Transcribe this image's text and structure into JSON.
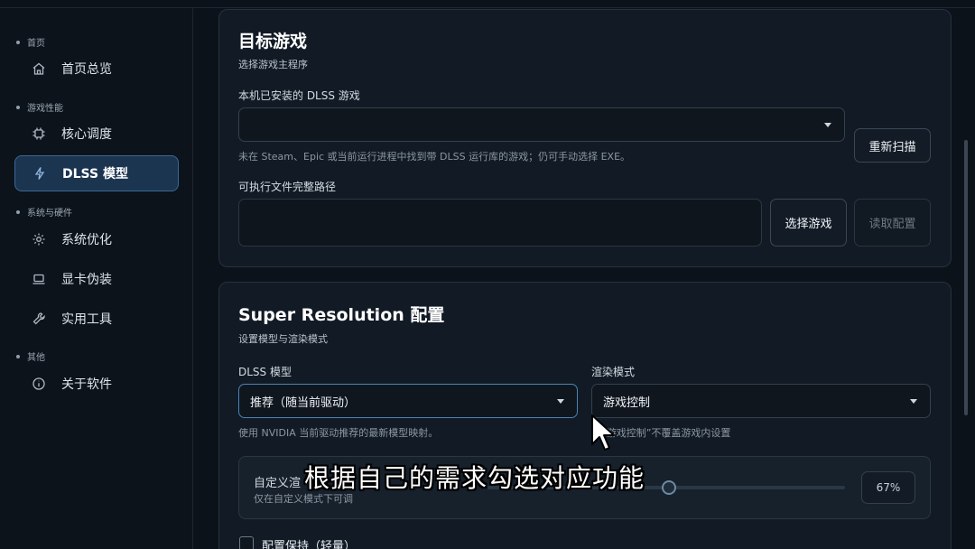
{
  "sidebar": {
    "sections": [
      "首页",
      "游戏性能",
      "系统与硬件",
      "其他"
    ],
    "items": [
      {
        "label": "首页总览",
        "icon": "home-icon"
      },
      {
        "label": "核心调度",
        "icon": "cpu-icon"
      },
      {
        "label": "DLSS 模型",
        "icon": "bolt-icon",
        "active": true
      },
      {
        "label": "系统优化",
        "icon": "gear-icon"
      },
      {
        "label": "显卡伪装",
        "icon": "laptop-icon"
      },
      {
        "label": "实用工具",
        "icon": "wrench-icon"
      },
      {
        "label": "关于软件",
        "icon": "info-icon"
      }
    ]
  },
  "target_game": {
    "title": "目标游戏",
    "subtitle": "选择游戏主程序",
    "installed_label": "本机已安装的 DLSS 游戏",
    "installed_value": "",
    "rescan_label": "重新扫描",
    "hint": "未在 Steam、Epic 或当前运行进程中找到带 DLSS 运行库的游戏；仍可手动选择 EXE。",
    "path_label": "可执行文件完整路径",
    "path_value": "",
    "select_game_label": "选择游戏",
    "read_config_label": "读取配置"
  },
  "super_resolution": {
    "title": "Super Resolution 配置",
    "subtitle": "设置模型与渲染模式",
    "model_label": "DLSS 模型",
    "model_value": "推荐（随当前驱动）",
    "model_hint": "使用 NVIDIA 当前驱动推荐的最新模型映射。",
    "render_label": "渲染模式",
    "render_value": "游戏控制",
    "render_hint": "“游戏控制”不覆盖游戏内设置",
    "custom_label": "自定义渲",
    "custom_hint": "仅在自定义模式下可调",
    "custom_percent": "67%",
    "custom_fraction": 0.67,
    "config_keep_label": "配置保持（轻量）"
  },
  "caption": "根据自己的需求勾选对应功能",
  "colors": {
    "accent": "#3a6a96",
    "active_bg": "#1b3450",
    "card_bg": "#121b25",
    "page_bg": "#0c1219"
  }
}
